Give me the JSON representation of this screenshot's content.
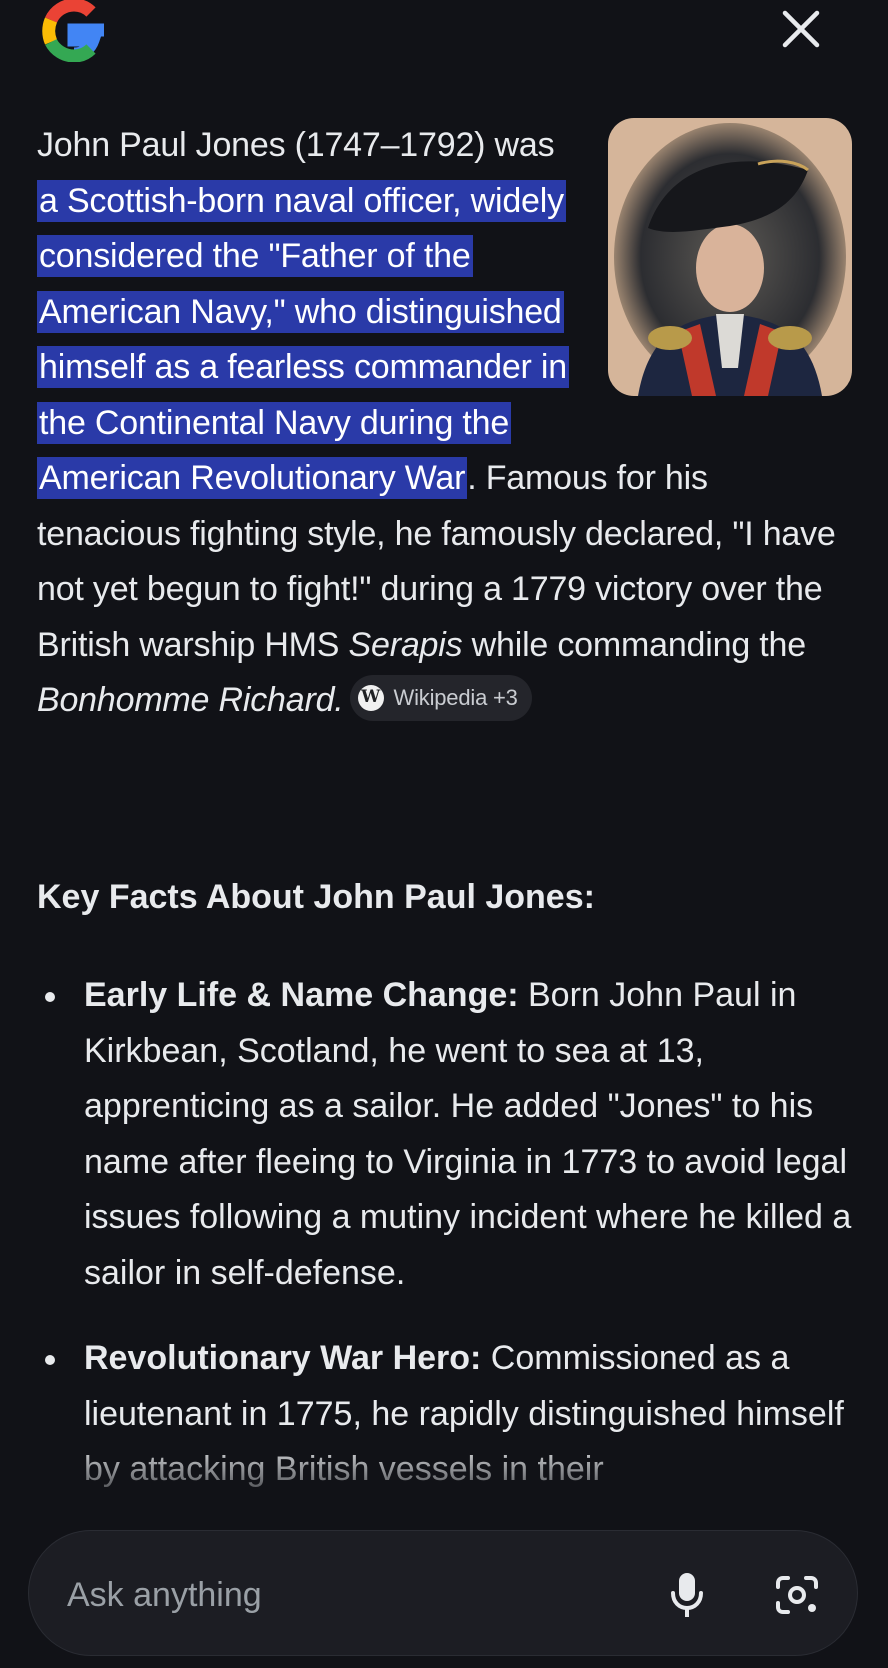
{
  "header": {
    "logo_icon": "google-g-logo",
    "close_icon": "close-icon"
  },
  "answer": {
    "intro_lead": "John Paul Jones (1747–1792) was ",
    "intro_highlight": "a Scottish-born naval officer, widely considered the \"Father of the American Navy,\" who distinguished himself as a fearless commander in the Continental Navy during the American Revolutionary War",
    "intro_after": ". Famous for his tenacious fighting style, he famously declared, \"I have not yet begun to fight!\" during a 1779 victory over the British warship HMS ",
    "ship1": "Serapis",
    "intro_mid": " while commanding the ",
    "ship2": "Bonhomme Richard.",
    "source_chip": {
      "icon": "wikipedia-icon",
      "icon_letter": "W",
      "label": "Wikipedia +3"
    },
    "portrait_icon": "portrait-image"
  },
  "key_facts": {
    "title": "Key Facts About John Paul Jones:",
    "items": [
      {
        "label": "Early Life & Name Change:",
        "text": " Born John Paul in Kirkbean, Scotland, he went to sea at 13, apprenticing as a sailor. He added \"Jones\" to his name after fleeing to Virginia in 1773 to avoid legal issues following a mutiny incident where he killed a sailor in self-defense."
      },
      {
        "label": "Revolutionary War Hero:",
        "text": " Commissioned as a lieutenant in 1775, he rapidly distinguished himself by attacking British vessels in their"
      }
    ]
  },
  "ask_bar": {
    "placeholder": "Ask anything",
    "mic_icon": "microphone-icon",
    "lens_icon": "camera-lens-icon"
  },
  "colors": {
    "background": "#111217",
    "highlight": "#2a3aa8",
    "text": "#e8eaed",
    "chip_bg": "#24252b"
  }
}
